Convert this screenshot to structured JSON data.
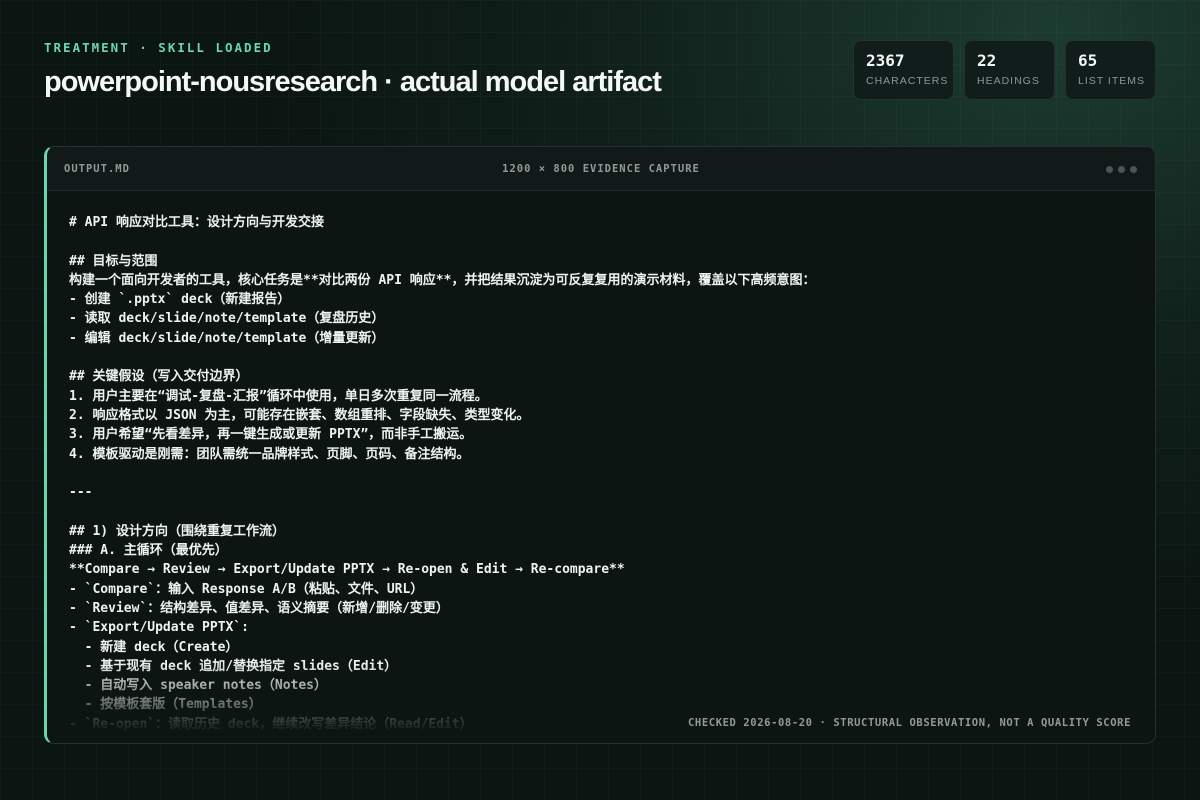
{
  "header": {
    "eyebrow": "TREATMENT · SKILL LOADED",
    "title": "powerpoint-nousresearch · actual model artifact"
  },
  "stats": [
    {
      "value": "2367",
      "label": "CHARACTERS"
    },
    {
      "value": "22",
      "label": "HEADINGS"
    },
    {
      "value": "65",
      "label": "LIST ITEMS"
    }
  ],
  "panel": {
    "filename": "OUTPUT.MD",
    "caption": "1200 × 800 EVIDENCE CAPTURE",
    "footer": "CHECKED 2026-08-20 · STRUCTURAL OBSERVATION, NOT A QUALITY SCORE",
    "content": "# API 响应对比工具：设计方向与开发交接\n\n## 目标与范围\n构建一个面向开发者的工具，核心任务是**对比两份 API 响应**，并把结果沉淀为可反复复用的演示材料，覆盖以下高频意图：\n- 创建 `.pptx` deck（新建报告）\n- 读取 deck/slide/note/template（复盘历史）\n- 编辑 deck/slide/note/template（增量更新）\n\n## 关键假设（写入交付边界）\n1. 用户主要在“调试-复盘-汇报”循环中使用，单日多次重复同一流程。\n2. 响应格式以 JSON 为主，可能存在嵌套、数组重排、字段缺失、类型变化。\n3. 用户希望“先看差异，再一键生成或更新 PPTX”，而非手工搬运。\n4. 模板驱动是刚需：团队需统一品牌样式、页脚、页码、备注结构。\n\n---\n\n## 1) 设计方向（围绕重复工作流）\n### A. 主循环（最优先）\n**Compare → Review → Export/Update PPTX → Re-open & Edit → Re-compare**\n- `Compare`：输入 Response A/B（粘贴、文件、URL）\n- `Review`：结构差异、值差异、语义摘要（新增/删除/变更）\n- `Export/Update PPTX`:\n  - 新建 deck（Create）\n  - 基于现有 deck 追加/替换指定 slides（Edit）\n  - 自动写入 speaker notes（Notes）\n  - 按模板套版（Templates）\n- `Re-open`：读取历史 deck，继续改写差异结论（Read/Edit）"
  },
  "colors": {
    "accent": "#69d7a9",
    "background": "#0b1512",
    "panel": "#0d1513"
  }
}
